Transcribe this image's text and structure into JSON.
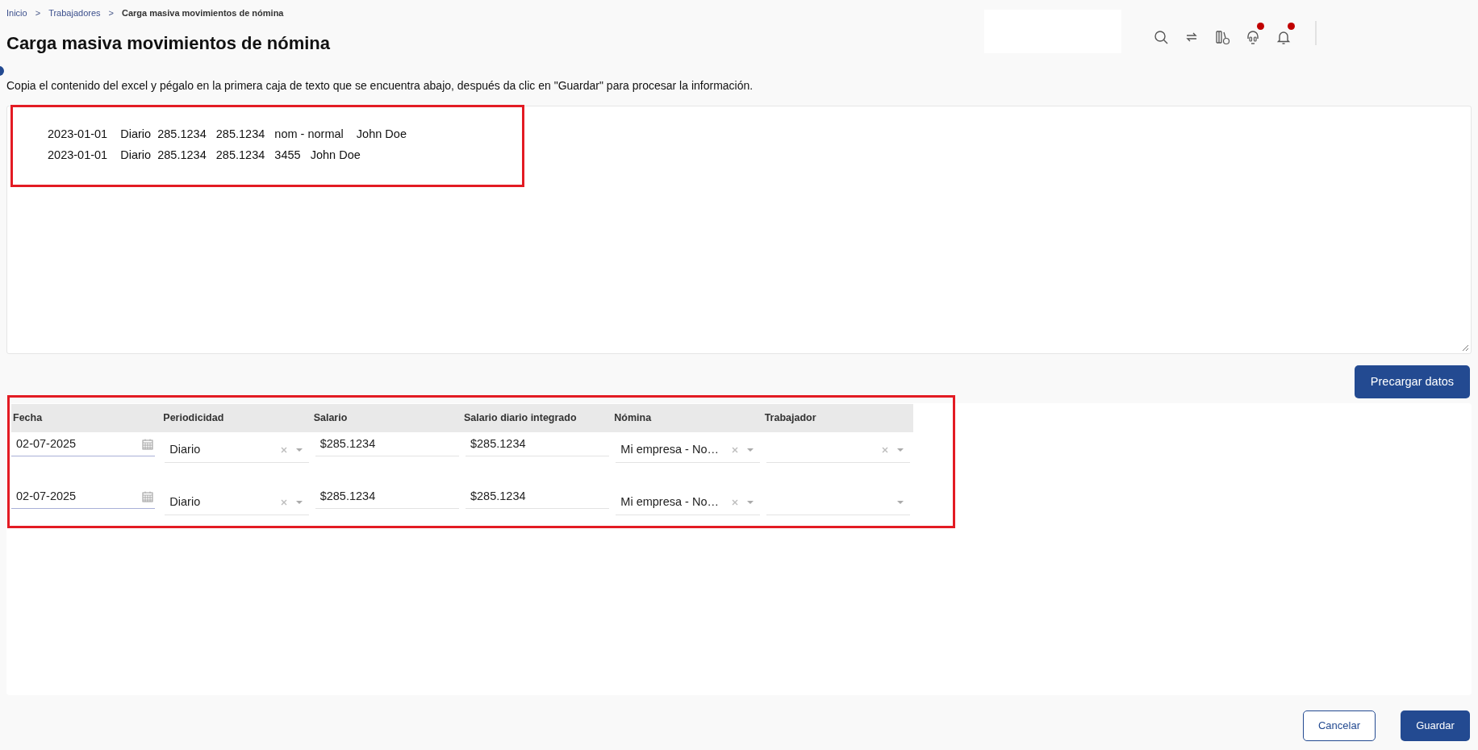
{
  "breadcrumb": [
    {
      "label": "Inicio",
      "current": false
    },
    {
      "label": "Trabajadores",
      "current": false
    },
    {
      "label": "Carga masiva movimientos de nómina",
      "current": true
    }
  ],
  "breadcrumb_separator": ">",
  "title": "Carga masiva movimientos de nómina",
  "header_icons": [
    {
      "kind": "search",
      "badge": false
    },
    {
      "kind": "sync",
      "badge": false
    },
    {
      "kind": "library",
      "badge": false
    },
    {
      "kind": "support",
      "badge": true
    },
    {
      "kind": "bell",
      "badge": true
    }
  ],
  "instructions": "Copia el contenido del excel y pégalo en la primera caja de texto que se encuentra abajo, después da clic en \"Guardar\" para procesar la información.",
  "paste_box": {
    "lines": [
      "2023-01-01    Diario  285.1234   285.1234   nom - normal    John Doe",
      "2023-01-01    Diario  285.1234   285.1234   3455   John Doe"
    ]
  },
  "preload_button": "Precargar datos",
  "table": {
    "columns": [
      "Fecha",
      "Periodicidad",
      "Salario",
      "Salario diario integrado",
      "Nómina",
      "Trabajador"
    ],
    "rows": [
      {
        "fecha": "02-07-2025",
        "periodicidad": {
          "value": "Diario",
          "clear": true
        },
        "salario": "$285.1234",
        "salario_diario_integrado": "$285.1234",
        "nomina": {
          "value": "Mi empresa - No…",
          "clear": true
        },
        "trabajador": {
          "clear": true
        }
      },
      {
        "fecha": "02-07-2025",
        "periodicidad": {
          "value": "Diario",
          "clear": true
        },
        "salario": "$285.1234",
        "salario_diario_integrado": "$285.1234",
        "nomina": {
          "value": "Mi empresa - No…",
          "clear": true
        },
        "trabajador": {
          "clear": false
        }
      }
    ]
  },
  "buttons": [
    {
      "label": "Cancelar",
      "kind": "secondary"
    },
    {
      "label": "Guardar",
      "kind": "primary"
    }
  ]
}
